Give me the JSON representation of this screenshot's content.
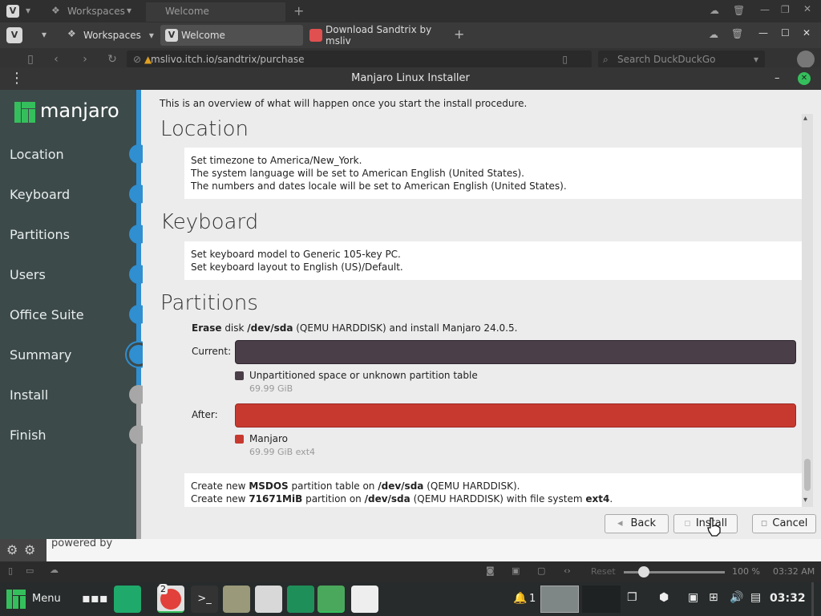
{
  "browser": {
    "ghost_tabs": [
      "Workspaces",
      "Welcome"
    ],
    "tabs": [
      {
        "label": "Workspaces"
      },
      {
        "label": "Welcome"
      },
      {
        "label": "Download Sandtrix by msliv"
      }
    ],
    "url": "mslivo.itch.io/sandtrix/purchase",
    "search_placeholder": "Search DuckDuckGo",
    "page_behind_text": "powered by"
  },
  "installer": {
    "title": "Manjaro Linux Installer",
    "brand": "manjaro",
    "steps": [
      {
        "label": "Location",
        "state": "done"
      },
      {
        "label": "Keyboard",
        "state": "done"
      },
      {
        "label": "Partitions",
        "state": "done"
      },
      {
        "label": "Users",
        "state": "done"
      },
      {
        "label": "Office Suite",
        "state": "done"
      },
      {
        "label": "Summary",
        "state": "current"
      },
      {
        "label": "Install",
        "state": "todo"
      },
      {
        "label": "Finish",
        "state": "todo"
      }
    ],
    "intro": "This is an overview of what will happen once you start the install procedure.",
    "location": {
      "heading": "Location",
      "lines": [
        "Set timezone to America/New_York.",
        "The system language will be set to American English (United States).",
        "The numbers and dates locale will be set to American English (United States)."
      ]
    },
    "keyboard": {
      "heading": "Keyboard",
      "lines": [
        "Set keyboard model to Generic 105-key PC.",
        "Set keyboard layout to English (US)/Default."
      ]
    },
    "partitions": {
      "heading": "Partitions",
      "erase_bold": "Erase",
      "erase_mid": " disk ",
      "erase_dev": "/dev/sda",
      "erase_rest": " (QEMU HARDDISK) and install Manjaro 24.0.5.",
      "current_label": "Current:",
      "current_legend": "Unpartitioned space or unknown partition table",
      "current_size": "69.99 GiB",
      "after_label": "After:",
      "after_legend": "Manjaro",
      "after_size": "69.99 GiB  ext4",
      "colors": {
        "current": "#4a3e48",
        "after": "#c7392f"
      },
      "ops": [
        {
          "a": "Create new ",
          "b": "MSDOS",
          "c": " partition table on ",
          "d": "/dev/sda",
          "e": " (QEMU HARDDISK)."
        },
        {
          "a": "Create new ",
          "b": "71671MiB",
          "c": " partition on ",
          "d": "/dev/sda",
          "e": " (QEMU HARDDISK) with file system ",
          "f": "ext4",
          "g": "."
        }
      ]
    },
    "buttons": {
      "back": "Back",
      "install": "Install",
      "cancel": "Cancel"
    }
  },
  "statusbar": {
    "reset": "Reset",
    "zoom": "100 %",
    "time": "03:32 AM"
  },
  "taskbar": {
    "menu": "Menu",
    "badge": "2",
    "workspace": "1",
    "clock": "03:32"
  }
}
